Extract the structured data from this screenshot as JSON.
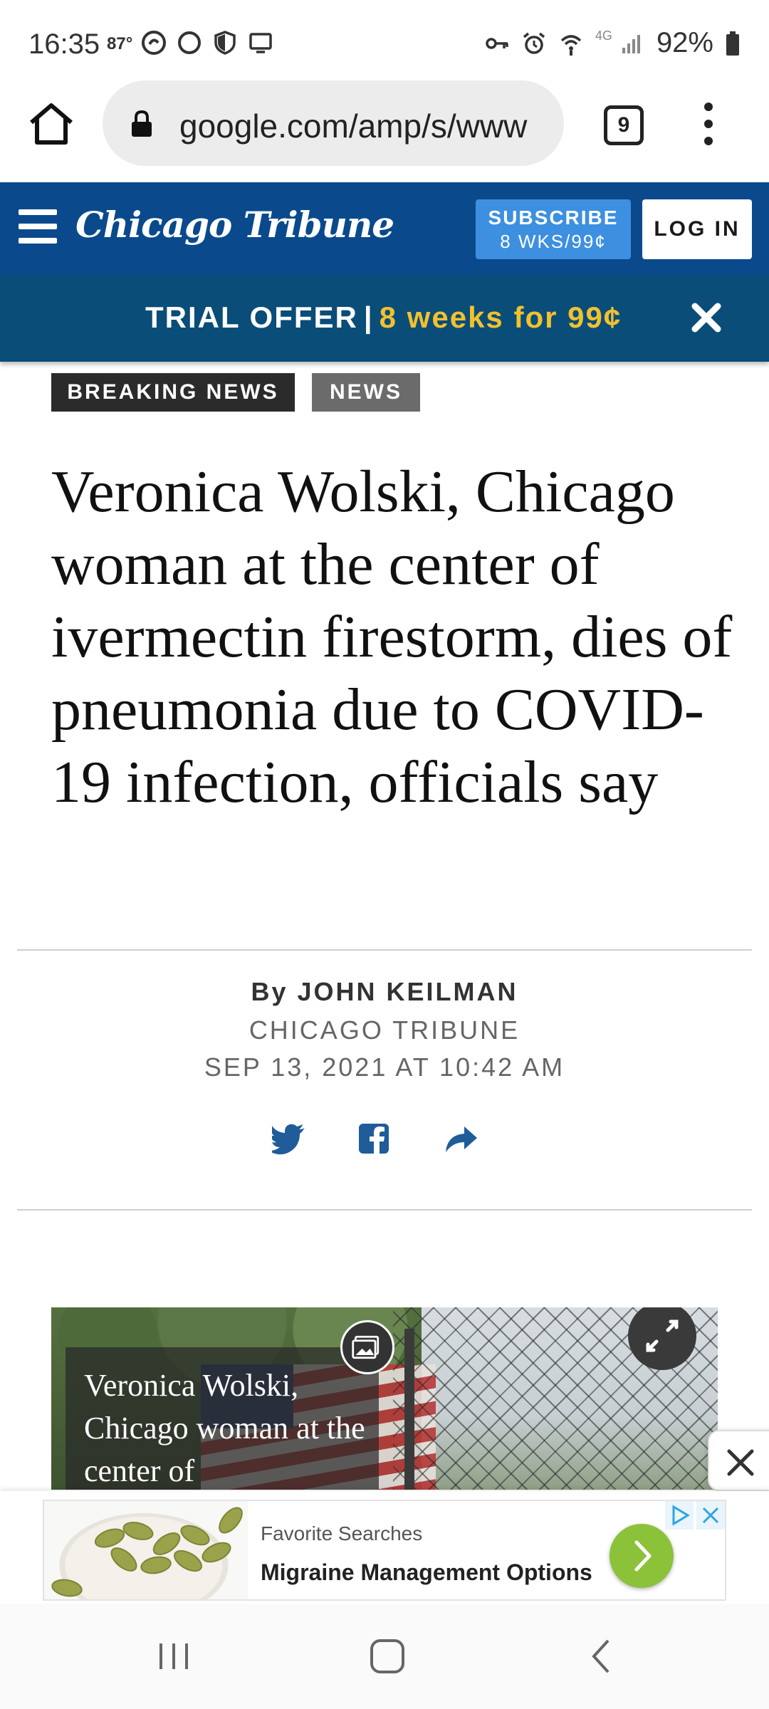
{
  "status_bar": {
    "time": "16:35",
    "temperature": "87°",
    "network": "4G",
    "battery": "92%"
  },
  "browser": {
    "url": "google.com/amp/s/www",
    "tab_count": "9",
    "icons": [
      "home-icon",
      "lock-icon",
      "tabs-icon",
      "more-vert-icon"
    ]
  },
  "header": {
    "logo": "Chicago Tribune",
    "subscribe_label": "SUBSCRIBE",
    "subscribe_offer": "8 WKS/99¢",
    "login_label": "LOG IN",
    "brand_color": "#0a4a8c"
  },
  "trial": {
    "label": "TRIAL OFFER",
    "separator": "|",
    "offer": "8 weeks for 99¢",
    "highlight_color": "#f2c12e"
  },
  "article": {
    "tags": [
      "BREAKING NEWS",
      "NEWS"
    ],
    "headline": "Veronica Wolski, Chicago woman at the center of ivermectin firestorm, dies of pneumonia due to COVID-19 infection, officials say",
    "byline_prefix": "By",
    "author": "JOHN KEILMAN",
    "source": "CHICAGO TRIBUNE",
    "date": "SEP 13, 2021 AT 10:42 AM",
    "share_icons": [
      "twitter-icon",
      "facebook-icon",
      "share-icon"
    ],
    "image_caption": "Veronica Wolski, Chicago woman at the center of"
  },
  "ad": {
    "label": "Favorite Searches",
    "title": "Migraine Management Options",
    "accent_color": "#8bc23a"
  }
}
